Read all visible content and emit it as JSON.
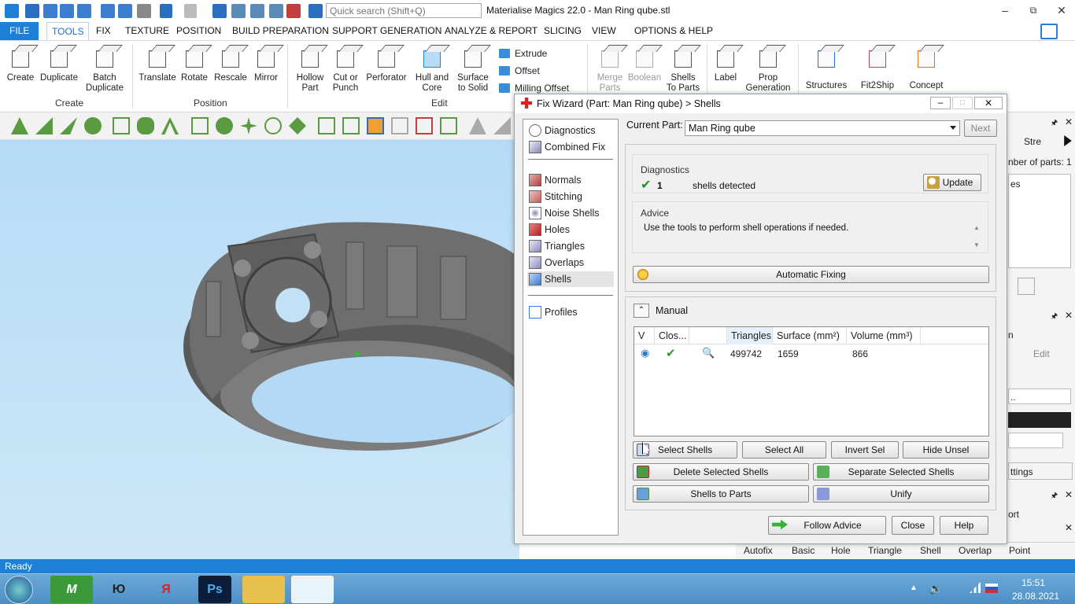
{
  "window": {
    "title": "Materialise Magics 22.0 - Man Ring qube.stl",
    "search_placeholder": "Quick search (Shift+Q)",
    "minimize": "–",
    "maximize": "⧉",
    "close": "✕"
  },
  "menu": [
    "FILE",
    "TOOLS",
    "FIX",
    "TEXTURE",
    "POSITION",
    "BUILD PREPARATION",
    "SUPPORT GENERATION",
    "ANALYZE & REPORT",
    "SLICING",
    "VIEW",
    "OPTIONS & HELP"
  ],
  "ribbon": {
    "create": [
      "Create",
      "Duplicate",
      "Batch\nDuplicate"
    ],
    "create_label": "Create",
    "position": [
      "Translate",
      "Rotate",
      "Rescale",
      "Mirror"
    ],
    "position_label": "Position",
    "edit": [
      "Hollow\nPart",
      "Cut or\nPunch",
      "Perforator",
      "Hull and\nCore",
      "Surface\nto Solid"
    ],
    "edit_small": [
      "Extrude",
      "Offset",
      "Milling Offset"
    ],
    "edit_label": "Edit",
    "other": [
      "Merge\nParts",
      "Boolean",
      "Shells\nTo Parts",
      "Label",
      "Prop\nGeneration"
    ],
    "extra": [
      "Structures",
      "Fit2Ship",
      "Concept"
    ]
  },
  "status": "Ready",
  "right_panel": {
    "tab1": "Stre",
    "parts": "nber of parts: 1",
    "list_item": "es",
    "rotation": "n",
    "edit_btn": "Edit",
    "field": "..",
    "settings": "ttings",
    "report": "ort"
  },
  "bottom_tabs": [
    "Autofix",
    "Basic",
    "Hole",
    "Triangle",
    "Shell",
    "Overlap",
    "Point"
  ],
  "taskbar": {
    "time": "15:51",
    "date": "28.08.2021",
    "apps": [
      "Ю",
      "Я",
      "Ps"
    ]
  },
  "dialog": {
    "title": "Fix Wizard (Part: Man Ring qube) > Shells",
    "nav_top": [
      "Diagnostics",
      "Combined Fix"
    ],
    "nav_items": [
      "Normals",
      "Stitching",
      "Noise Shells",
      "Holes",
      "Triangles",
      "Overlaps",
      "Shells"
    ],
    "nav_bottom": "Profiles",
    "current_part_label": "Current Part:",
    "current_part_value": "Man Ring qube",
    "next": "Next",
    "diagnostics_title": "Diagnostics",
    "diag_count": "1",
    "diag_text": "shells detected",
    "update": "Update",
    "advice_title": "Advice",
    "advice_text": "Use the tools to perform shell operations if needed.",
    "auto_fix": "Automatic Fixing",
    "manual": "Manual",
    "table": {
      "headers": [
        "V",
        "Clos...",
        "",
        "Triangles",
        "Surface (mm²)",
        "Volume (mm³)"
      ],
      "row": {
        "triangles": "499742",
        "surface": "1659",
        "volume": "866"
      }
    },
    "buttons": {
      "select_shells": "Select Shells",
      "select_all": "Select All",
      "invert_sel": "Invert Sel",
      "hide_unsel": "Hide Unsel",
      "delete_selected": "Delete Selected Shells",
      "separate_selected": "Separate Selected Shells",
      "shells_to_parts": "Shells to Parts",
      "unify": "Unify",
      "follow_advice": "Follow Advice",
      "close": "Close",
      "help": "Help"
    }
  }
}
